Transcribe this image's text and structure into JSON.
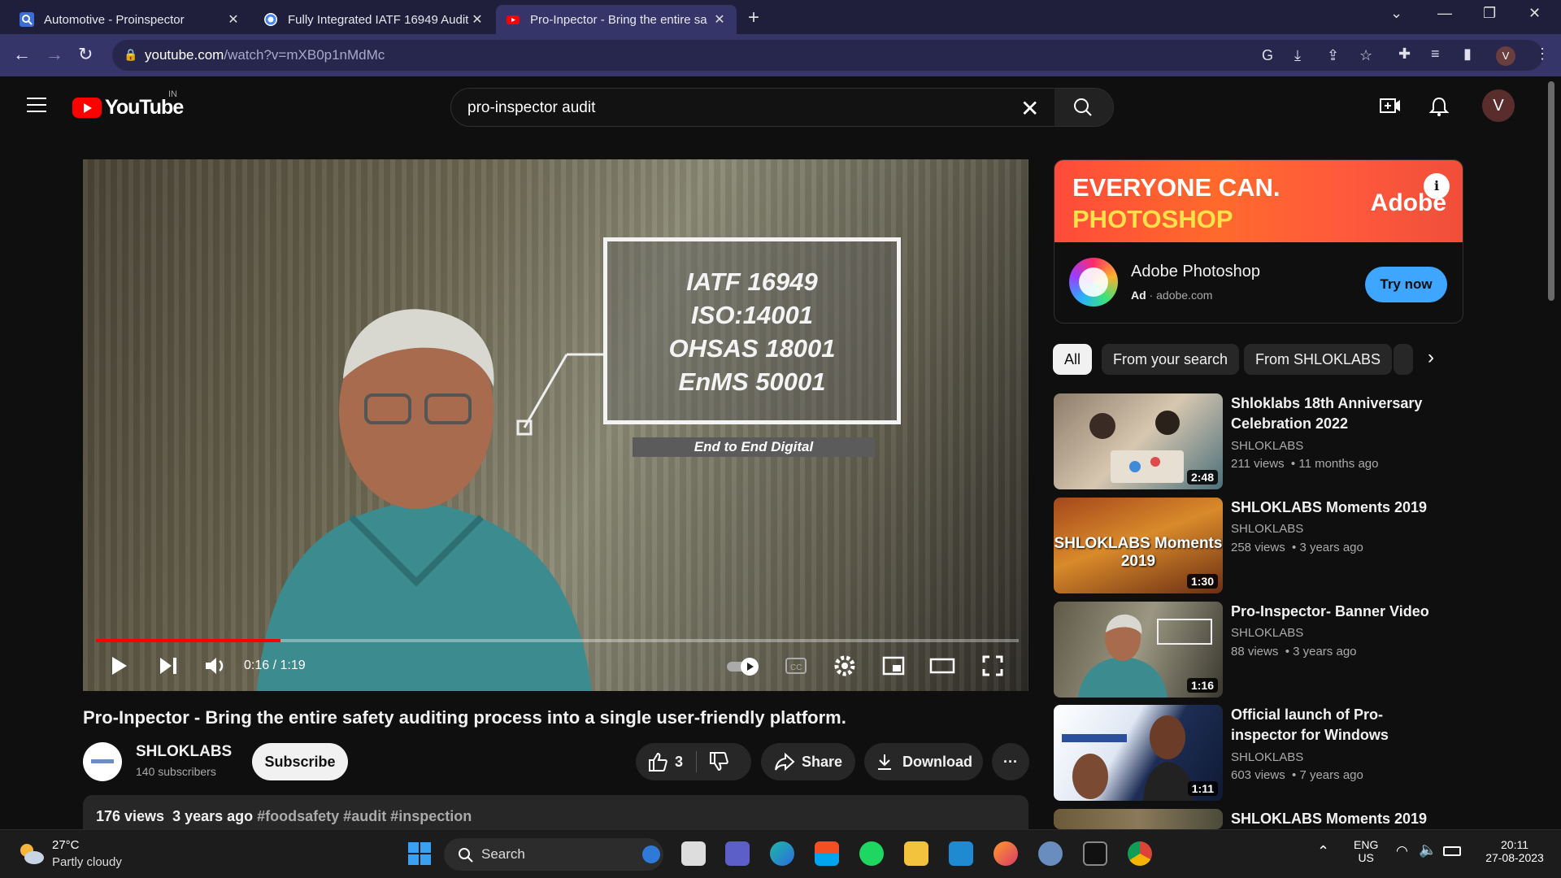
{
  "browser": {
    "tabs": [
      {
        "title": "Automotive - Proinspector",
        "close": "✕"
      },
      {
        "title": "Fully Integrated IATF 16949 Audit",
        "close": "✕"
      },
      {
        "title": "Pro-Inpector - Bring the entire sa",
        "close": "✕"
      }
    ],
    "new_tab": "+",
    "url_host": "youtube.com",
    "url_path": "/watch?v=mXB0p1nMdMc",
    "profile_initial": "V"
  },
  "youtube": {
    "logo_text": "YouTube",
    "country": "IN",
    "search_query": "pro-inspector audit",
    "user_initial": "V"
  },
  "video": {
    "overlay_lines": [
      "IATF 16949",
      "ISO:14001",
      "OHSAS 18001",
      "EnMS 50001"
    ],
    "overlay_caption": "End to End Digital",
    "time": "0:16 / 1:19",
    "progress_fraction": 0.2,
    "title": "Pro-Inpector - Bring the entire safety auditing process into a single user-friendly platform.",
    "channel": "SHLOKLABS",
    "subscribers": "140 subscribers",
    "subscribe_label": "Subscribe",
    "likes": "3",
    "share_label": "Share",
    "download_label": "Download",
    "views_age": "176 views  3 years ago",
    "tags": "#foodsafety #audit #inspection"
  },
  "ad": {
    "banner_line1": "EVERYONE CAN.",
    "banner_line2": "PHOTOSHOP",
    "banner_brand": "Adobe",
    "name": "Adobe Photoshop",
    "ad_label": "Ad",
    "domain": "adobe.com",
    "cta": "Try now"
  },
  "chips": [
    "All",
    "From your search",
    "From SHLOKLABS"
  ],
  "recommendations": [
    {
      "title": "Shloklabs 18th Anniversary Celebration 2022",
      "channel": "SHLOKLABS",
      "meta": "211 views  • 11 months ago",
      "duration": "2:48",
      "thumb_text": ""
    },
    {
      "title": "SHLOKLABS Moments 2019",
      "channel": "SHLOKLABS",
      "meta": "258 views  • 3 years ago",
      "duration": "1:30",
      "thumb_text": "SHLOKLABS Moments 2019"
    },
    {
      "title": "Pro-Inspector- Banner Video",
      "channel": "SHLOKLABS",
      "meta": "88 views  • 3 years ago",
      "duration": "1:16",
      "thumb_text": ""
    },
    {
      "title": "Official launch of Pro-inspector for Windows",
      "channel": "SHLOKLABS",
      "meta": "603 views  • 7 years ago",
      "duration": "1:11",
      "thumb_text": ""
    },
    {
      "title": "SHLOKLABS Moments 2019",
      "channel": "",
      "meta": "",
      "duration": "",
      "thumb_text": ""
    }
  ],
  "taskbar": {
    "temp": "27°C",
    "weather": "Partly cloudy",
    "search_label": "Search",
    "lang1": "ENG",
    "lang2": "US",
    "time": "20:11",
    "date": "27-08-2023"
  }
}
